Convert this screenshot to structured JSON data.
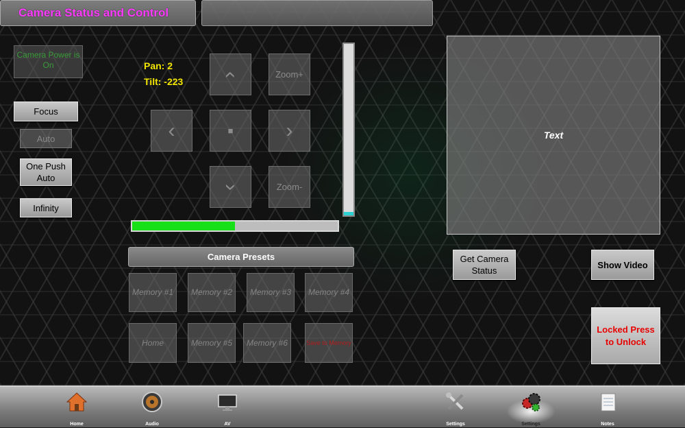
{
  "header": {
    "title": "Camera Status and Control"
  },
  "camera": {
    "power_status": "Camera Power is On",
    "pan": "Pan: 2",
    "tilt": "Tilt: -223"
  },
  "focus": {
    "focus_label": "Focus",
    "auto_label": "Auto",
    "one_push_label": "One Push Auto",
    "infinity_label": "Infinity"
  },
  "ptz": {
    "up_icon": "‹",
    "left_icon": "‹",
    "right_icon": "›",
    "down_icon": "›",
    "stop_icon": "■",
    "zoom_in": "Zoom+",
    "zoom_out": "Zoom-"
  },
  "levels": {
    "focus_slider": 0.02,
    "progress": 0.5
  },
  "presets": {
    "header": "Camera Presets",
    "items": [
      "Memory #1",
      "Memory #2",
      "Memory #3",
      "Memory #4",
      "Home",
      "Memory #5",
      "Memory #6",
      "Save to Memory"
    ]
  },
  "video": {
    "text": "Text"
  },
  "actions": {
    "get_status": "Get Camera Status",
    "show_video": "Show Video",
    "locked": "Locked Press to Unlock"
  },
  "nav": [
    {
      "label": "Home",
      "icon": "house-icon"
    },
    {
      "label": "Audio",
      "icon": "speaker-icon"
    },
    {
      "label": "AV",
      "icon": "monitor-icon"
    },
    {
      "label": "Settings",
      "icon": "tools-icon"
    },
    {
      "label": "Settings",
      "icon": "gears-icon"
    },
    {
      "label": "Notes",
      "icon": "notepad-icon"
    }
  ],
  "colors": {
    "title": "#ff3cff",
    "readout": "#f3e600",
    "progress": "#18e018",
    "locked_text": "#e80000"
  }
}
